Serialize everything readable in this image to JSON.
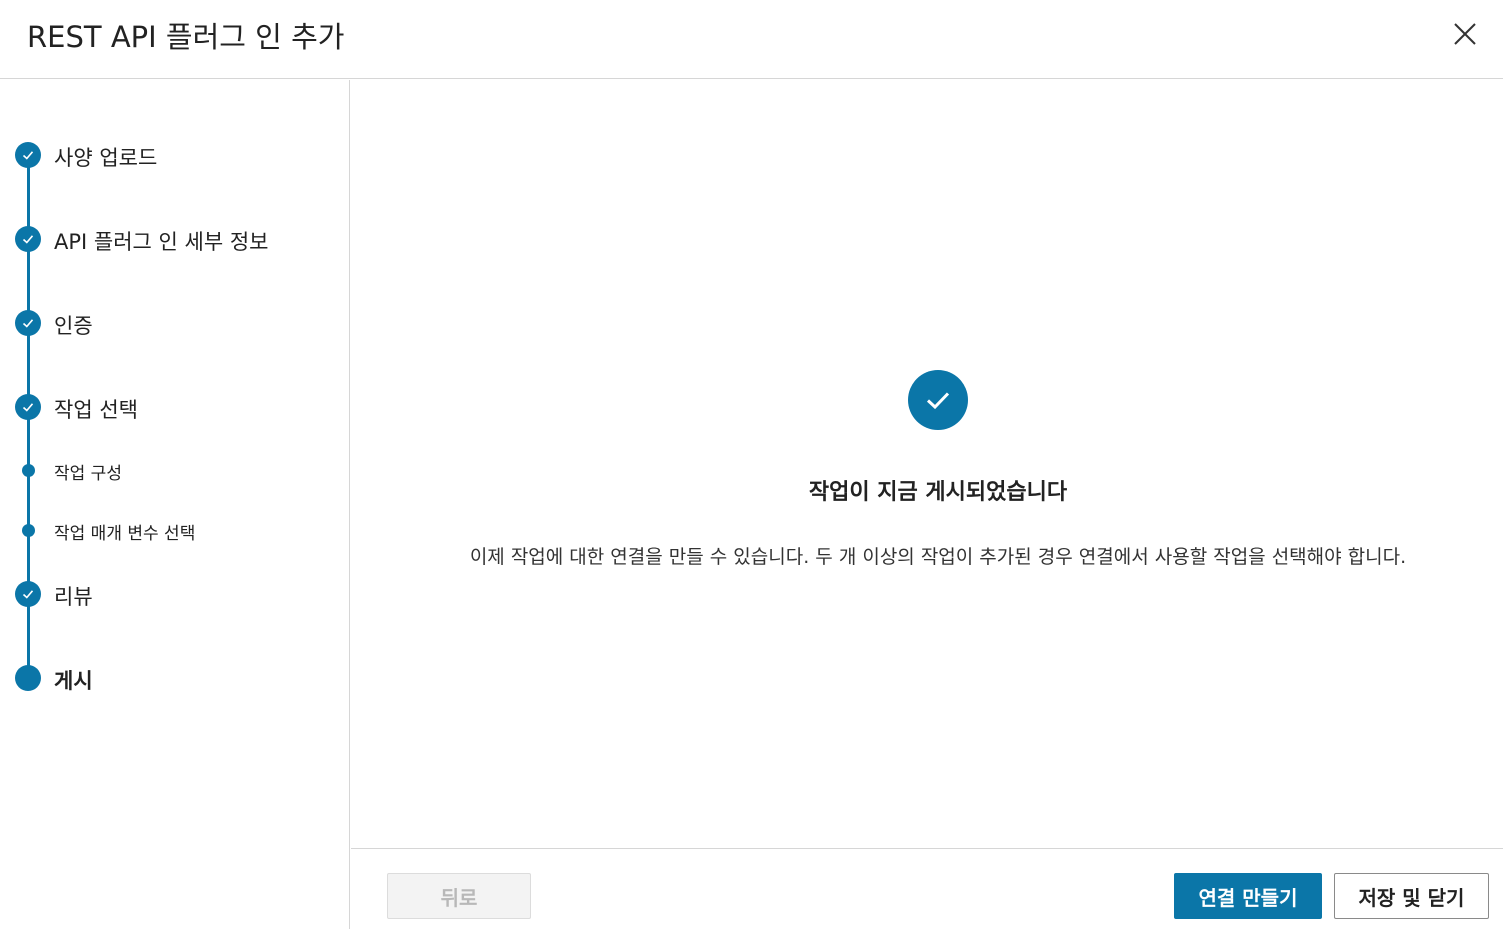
{
  "dialog": {
    "title": "REST API 플러그 인 추가",
    "close_icon": "close-icon"
  },
  "steps": [
    {
      "label": "사양 업로드",
      "state": "completed"
    },
    {
      "label": "API 플러그 인 세부 정보",
      "state": "completed"
    },
    {
      "label": "인증",
      "state": "completed"
    },
    {
      "label": "작업 선택",
      "state": "completed"
    },
    {
      "label": "작업 구성",
      "state": "substep"
    },
    {
      "label": "작업 매개 변수 선택",
      "state": "substep"
    },
    {
      "label": "리뷰",
      "state": "completed"
    },
    {
      "label": "게시",
      "state": "current"
    }
  ],
  "main": {
    "status_icon": "check-circle-icon",
    "heading": "작업이 지금 게시되었습니다",
    "description": "이제 작업에 대한 연결을 만들 수 있습니다. 두 개 이상의 작업이 추가된 경우 연결에서 사용할 작업을 선택해야 합니다."
  },
  "footer": {
    "back_label": "뒤로",
    "back_disabled": true,
    "create_connection_label": "연결 만들기",
    "save_close_label": "저장 및 닫기"
  },
  "colors": {
    "accent": "#0b76a8",
    "border": "#d6d6d6",
    "disabled_text": "#b8b8b8"
  }
}
